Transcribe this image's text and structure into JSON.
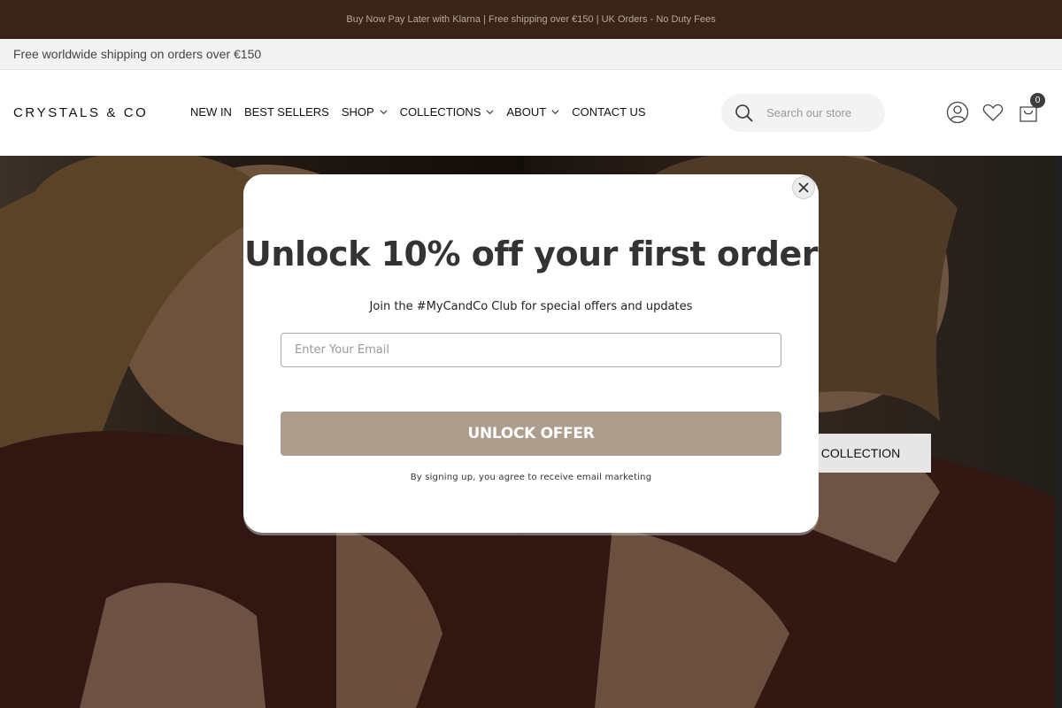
{
  "announcement": {
    "text": "Buy Now Pay Later with Klarna | Free shipping over €150 | UK Orders - No Duty Fees"
  },
  "shipping_bar": {
    "text": "Free worldwide shipping on orders over €150"
  },
  "header": {
    "logo": "CRYSTALS & CO",
    "nav": [
      {
        "label": "NEW IN",
        "has_dropdown": false
      },
      {
        "label": "BEST SELLERS",
        "has_dropdown": false
      },
      {
        "label": "SHOP",
        "has_dropdown": true
      },
      {
        "label": "COLLECTIONS",
        "has_dropdown": true
      },
      {
        "label": "ABOUT",
        "has_dropdown": true
      },
      {
        "label": "CONTACT US",
        "has_dropdown": false
      }
    ],
    "search": {
      "placeholder": "Search our store",
      "value": ""
    },
    "icons": [
      "search-icon",
      "account-icon",
      "wishlist-icon",
      "cart-icon"
    ],
    "cart_count": "0"
  },
  "hero": {
    "cta_label": "NEW JOANNA COOPER COLLECTION"
  },
  "popup": {
    "title": "Unlock 10% off your first order",
    "subtitle": "Join the #MyCandCo Club for special offers and updates",
    "email_placeholder": "Enter Your Email",
    "email_value": "",
    "button_label": "UNLOCK OFFER",
    "legal": "By signing up, you agree to receive email marketing"
  },
  "colors": {
    "announcement_bg": "#3a2418",
    "button_accent": "#ad9d8d",
    "overlay": "rgba(0,0,0,0.45)"
  }
}
